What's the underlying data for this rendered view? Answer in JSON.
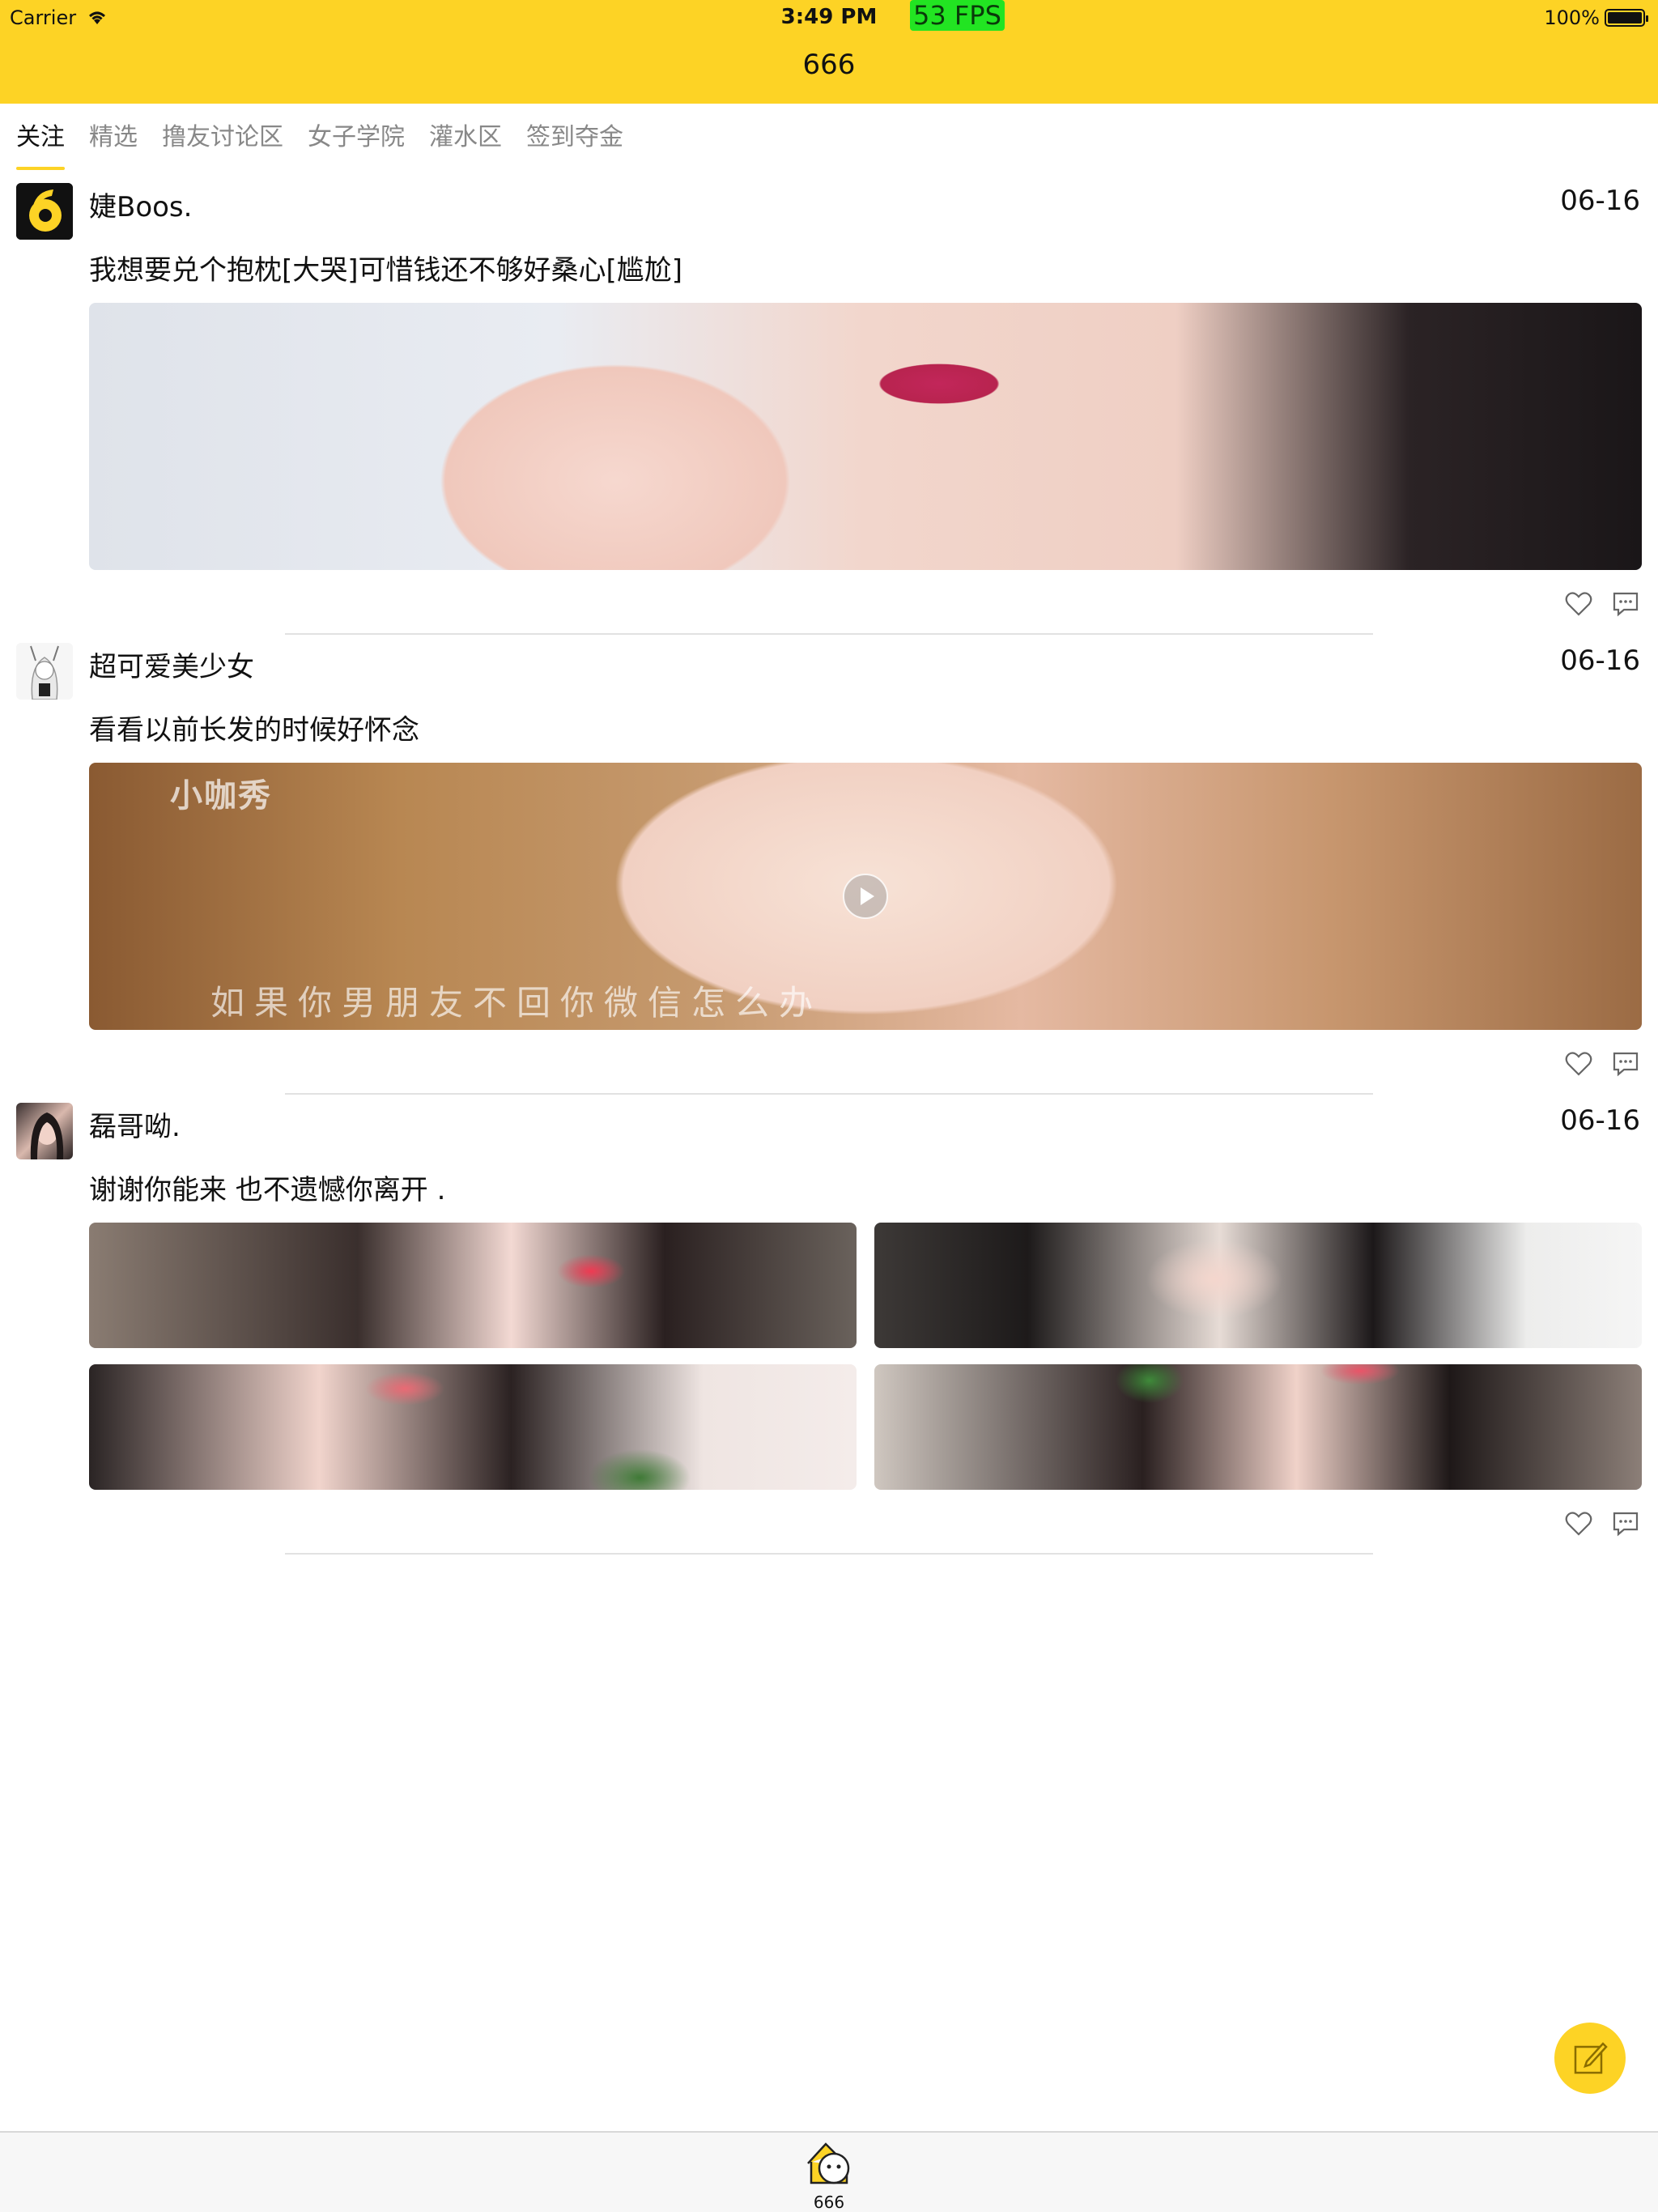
{
  "status_bar": {
    "carrier": "Carrier",
    "time": "3:49 PM",
    "fps": "53 FPS",
    "battery": "100%"
  },
  "nav": {
    "title": "666"
  },
  "tabs": [
    {
      "label": "关注",
      "active": true
    },
    {
      "label": "精选"
    },
    {
      "label": "撸友讨论区"
    },
    {
      "label": "女子学院"
    },
    {
      "label": "灌水区"
    },
    {
      "label": "签到夺金"
    }
  ],
  "posts": [
    {
      "username": "婕Boos.",
      "date": "06-16",
      "content": "我想要兑个抱枕[大哭]可惜钱还不够好桑心[尴尬]",
      "media": "photo"
    },
    {
      "username": "超可爱美少女",
      "date": "06-16",
      "content": "看看以前长发的时候好怀念",
      "media": "video",
      "watermark": "小咖秀",
      "subtitle": "如果你男朋友不回你微信怎么办"
    },
    {
      "username": "磊哥呦.",
      "date": "06-16",
      "content": "谢谢你能来 也不遗憾你离开 .",
      "media": "grid"
    }
  ],
  "tabbar": {
    "label": "666"
  },
  "colors": {
    "accent": "#fdd325",
    "fps_badge": "#22e422"
  }
}
